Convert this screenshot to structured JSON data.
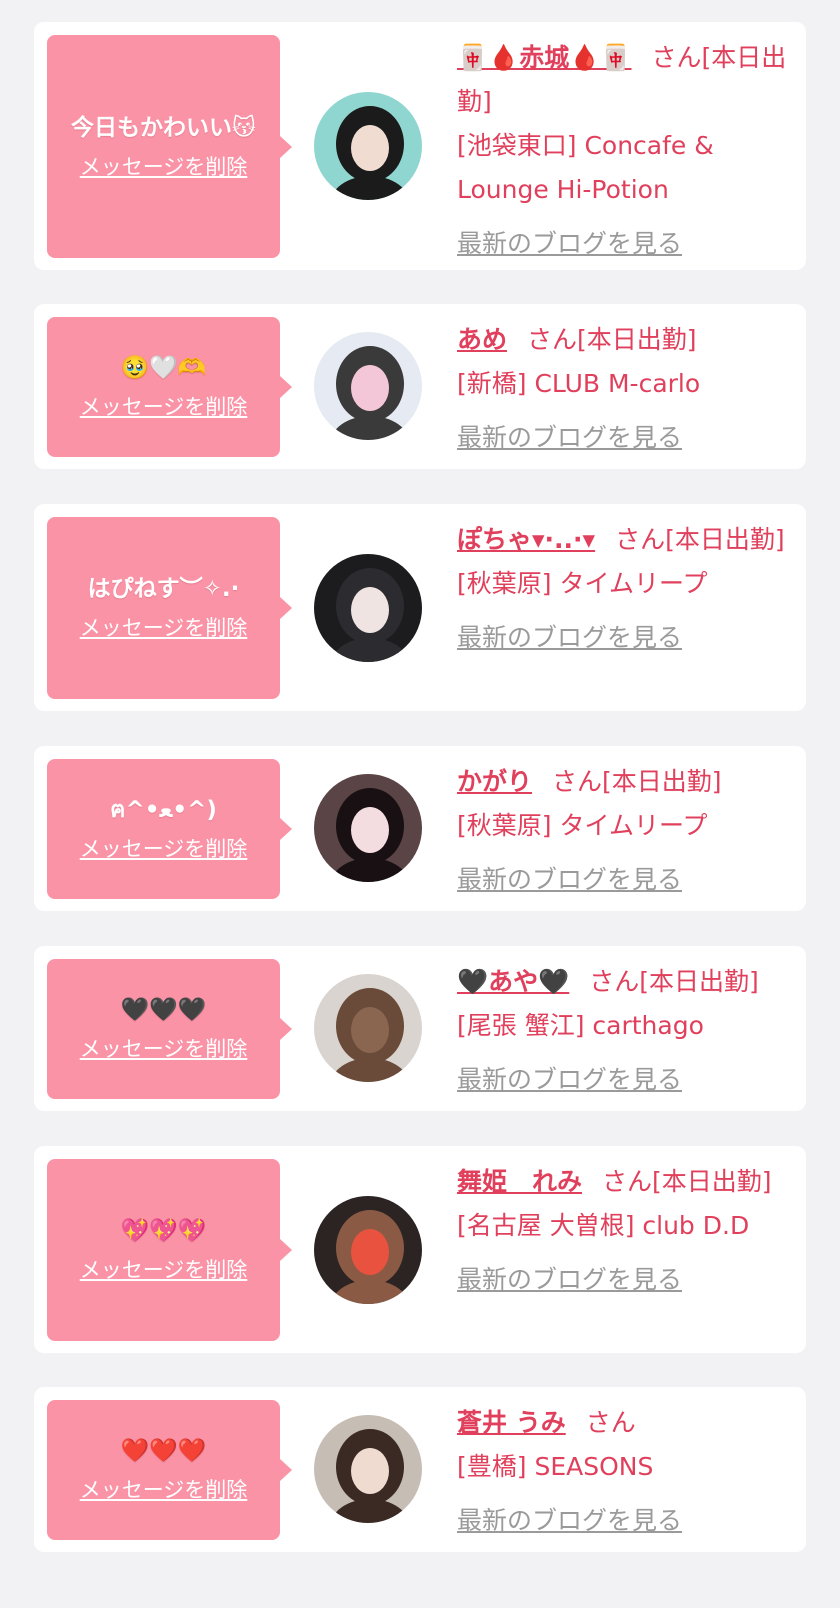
{
  "cards": [
    {
      "message": "今日もかわいい😽",
      "delete_label": "メッセージを削除",
      "name": "🀄🩸赤城🩸🀄",
      "honorific": "さん",
      "status": "[本日出勤]",
      "shop": "[池袋東口] Concafe & Lounge Hi-Potion",
      "blog_label": "最新のブログを見る",
      "avatar_colors": [
        "#8fd6d0",
        "#1b1b1b",
        "#f1dcd2"
      ]
    },
    {
      "message": "🥹🤍🫶",
      "delete_label": "メッセージを削除",
      "name": "あめ",
      "honorific": "さん",
      "status": "[本日出勤]",
      "shop": "[新橋] CLUB M-carlo",
      "blog_label": "最新のブログを見る",
      "avatar_colors": [
        "#e6eaf2",
        "#3a3a3a",
        "#f3c6d8"
      ]
    },
    {
      "message": "はぴねす︶✧.·",
      "delete_label": "メッセージを削除",
      "name": "ぽちゃ▾·..·▾",
      "honorific": "さん",
      "status": "[本日出勤]",
      "shop": "[秋葉原] タイムリープ",
      "blog_label": "最新のブログを見る",
      "avatar_colors": [
        "#1c1c1e",
        "#2c2c30",
        "#efe4e2"
      ]
    },
    {
      "message": "ฅ^•ﻌ•^)",
      "delete_label": "メッセージを削除",
      "name": "かがり",
      "honorific": "さん",
      "status": "[本日出勤]",
      "shop": "[秋葉原] タイムリープ",
      "blog_label": "最新のブログを見る",
      "avatar_colors": [
        "#5a4446",
        "#181012",
        "#f4dde0"
      ]
    },
    {
      "message": "🖤🖤🖤",
      "delete_label": "メッセージを削除",
      "name": "🖤あや🖤",
      "honorific": "さん",
      "status": "[本日出勤]",
      "shop": "[尾張 蟹江] carthago",
      "blog_label": "最新のブログを見る",
      "avatar_colors": [
        "#d9d4cf",
        "#6a4a38",
        "#8a6650"
      ]
    },
    {
      "message": "💖💖💖",
      "delete_label": "メッセージを削除",
      "name": "舞姫　れみ",
      "honorific": "さん",
      "status": "[本日出勤]",
      "shop": "[名古屋 大曽根] club D.D",
      "blog_label": "最新のブログを見る",
      "avatar_colors": [
        "#2b2422",
        "#8a5a45",
        "#e8523e"
      ]
    },
    {
      "message": "❤️❤️❤️",
      "delete_label": "メッセージを削除",
      "name": "蒼井 うみ",
      "honorific": "さん",
      "status": "",
      "shop": "[豊橋] SEASONS",
      "blog_label": "最新のブログを見る",
      "avatar_colors": [
        "#c6bdb5",
        "#3b2a24",
        "#f0dbd0"
      ]
    }
  ]
}
